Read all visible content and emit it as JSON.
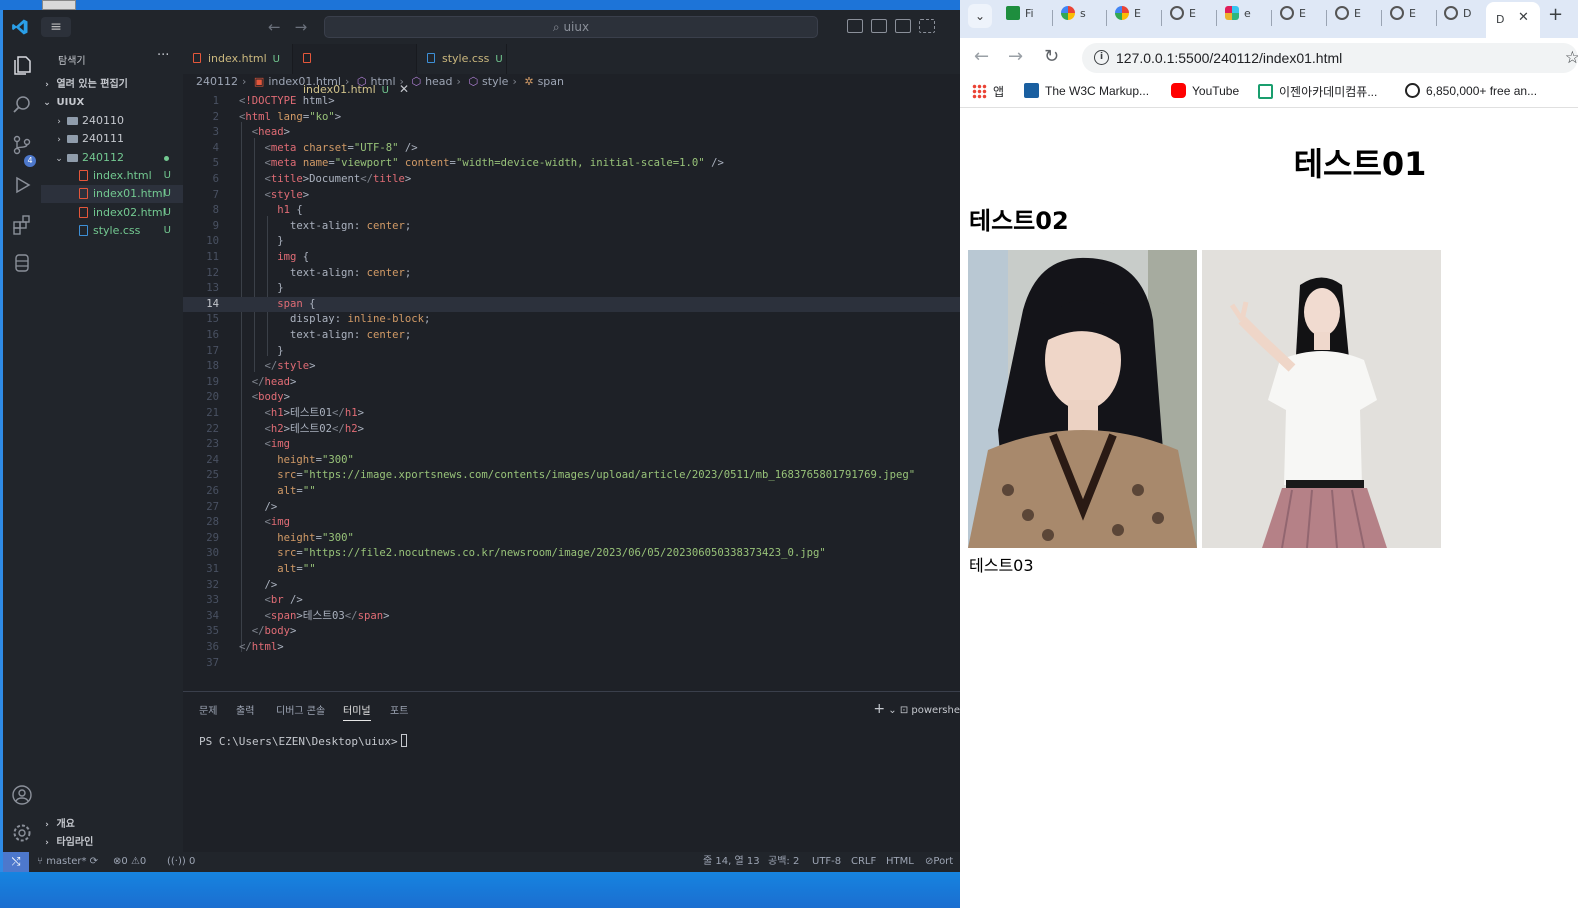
{
  "vscode": {
    "search_placeholder": "uiux",
    "menu_icon": "hamburger-icon",
    "explorer": {
      "title": "탐색기",
      "more": "···",
      "open_editors": "열려 있는 편집기",
      "root": "UIUX",
      "items": [
        {
          "label": "240110",
          "type": "folder",
          "status": ""
        },
        {
          "label": "240111",
          "type": "folder",
          "status": ""
        },
        {
          "label": "240112",
          "type": "folder-open",
          "status": "dot"
        },
        {
          "label": "index.html",
          "type": "html",
          "status": "U"
        },
        {
          "label": "index01.html",
          "type": "html",
          "status": "U"
        },
        {
          "label": "index02.html",
          "type": "html",
          "status": "U"
        },
        {
          "label": "style.css",
          "type": "css",
          "status": "U"
        }
      ],
      "outline": "개요",
      "timeline": "타임라인"
    },
    "source_control_badge": "4",
    "tabs": [
      {
        "label": "index.html",
        "status": "U",
        "type": "html"
      },
      {
        "label": "index01.html",
        "status": "U",
        "type": "html",
        "active": true
      },
      {
        "label": "style.css",
        "status": "U",
        "type": "css"
      }
    ],
    "breadcrumb": [
      "240112",
      "index01.html",
      "html",
      "head",
      "style",
      "span"
    ],
    "code_lines": [
      "<!DOCTYPE html>",
      "<html lang=\"ko\">",
      "  <head>",
      "    <meta charset=\"UTF-8\" />",
      "    <meta name=\"viewport\" content=\"width=device-width, initial-scale=1.0\" />",
      "    <title>Document</title>",
      "    <style>",
      "      h1 {",
      "        text-align: center;",
      "      }",
      "      img {",
      "        text-align: center;",
      "      }",
      "      span {",
      "        display: inline-block;",
      "        text-align: center;",
      "      }",
      "    </style>",
      "  </head>",
      "  <body>",
      "    <h1>테스트01</h1>",
      "    <h2>테스트02</h2>",
      "    <img",
      "      height=\"300\"",
      "      src=\"https://image.xportsnews.com/contents/images/upload/article/2023/0511/mb_1683765801791769.jpeg\"",
      "      alt=\"\"",
      "    />",
      "    <img",
      "      height=\"300\"",
      "      src=\"https://file2.nocutnews.co.kr/newsroom/image/2023/06/05/202306050338373423_0.jpg\"",
      "      alt=\"\"",
      "    />",
      "    <br />",
      "    <span>테스트03</span>",
      "  </body>",
      "</html>",
      ""
    ],
    "current_line": 14,
    "panel": {
      "tabs": [
        "문제",
        "출력",
        "디버그 콘솔",
        "터미널",
        "포트"
      ],
      "active_tab": "터미널",
      "terminal_line": "PS C:\\Users\\EZEN\\Desktop\\uiux>",
      "shell": "powershe"
    },
    "status": {
      "branch": "master*",
      "errors": "0",
      "warnings": "0",
      "ports": "0",
      "position": "줄 14, 열 13",
      "spaces": "공백: 2",
      "encoding": "UTF-8",
      "eol": "CRLF",
      "language": "HTML",
      "port": "Port"
    }
  },
  "chrome": {
    "tabs": [
      "Fi",
      "s",
      "E",
      "E",
      "e",
      "E",
      "E",
      "E",
      "D"
    ],
    "active_tab": "D",
    "url": "127.0.0.1:5500/240112/index01.html",
    "bookmarks": [
      "앱",
      "The W3C Markup...",
      "YouTube",
      "이젠아카데미컴퓨...",
      "6,850,000+ free an..."
    ],
    "page": {
      "h1": "테스트01",
      "h2": "테스트02",
      "caption": "테스트03"
    }
  },
  "colors": {
    "editor_bg": "#1e2127",
    "sidebar_bg": "#21252b",
    "accent": "#4d78cc",
    "untracked": "#73c991",
    "tag": "#e06c75",
    "attr": "#d19a66",
    "string": "#98c379",
    "chrome_tabstrip": "#dfe8f6"
  }
}
